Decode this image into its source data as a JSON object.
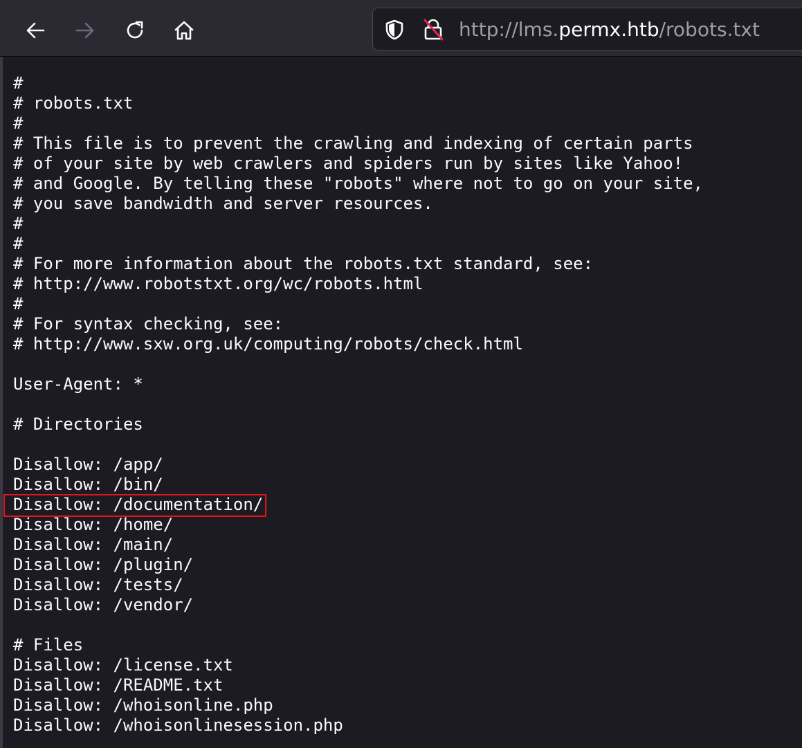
{
  "toolbar": {
    "back_icon": "arrow-left-icon",
    "forward_icon": "arrow-right-icon",
    "reload_icon": "reload-icon",
    "home_icon": "home-icon"
  },
  "urlbar": {
    "shield_icon": "shield-icon",
    "lock_icon": "insecure-lock-icon",
    "url_prefix": "http://lms.",
    "url_domain": "permx.htb",
    "url_path": "/robots.txt"
  },
  "document": {
    "lines": [
      "#",
      "# robots.txt",
      "#",
      "# This file is to prevent the crawling and indexing of certain parts",
      "# of your site by web crawlers and spiders run by sites like Yahoo!",
      "# and Google. By telling these \"robots\" where not to go on your site,",
      "# you save bandwidth and server resources.",
      "#",
      "#",
      "# For more information about the robots.txt standard, see:",
      "# http://www.robotstxt.org/wc/robots.html",
      "#",
      "# For syntax checking, see:",
      "# http://www.sxw.org.uk/computing/robots/check.html",
      "",
      "User-Agent: *",
      "",
      "# Directories",
      "",
      "Disallow: /app/",
      "Disallow: /bin/",
      "Disallow: /documentation/",
      "Disallow: /home/",
      "Disallow: /main/",
      "Disallow: /plugin/",
      "Disallow: /tests/",
      "Disallow: /vendor/",
      "",
      "# Files",
      "Disallow: /license.txt",
      "Disallow: /README.txt",
      "Disallow: /whoisonline.php",
      "Disallow: /whoisonlinesession.php"
    ]
  },
  "highlight": {
    "color": "#e3141c",
    "highlighted_line": "Disallow: /documentation/"
  }
}
